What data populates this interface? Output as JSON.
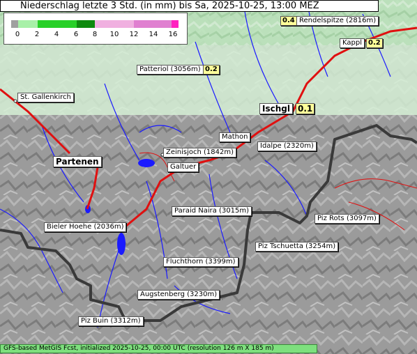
{
  "title": "Niederschlag letzte 3 Std. (in mm) bis Sa, 2025-10-25, 13:00 MEZ",
  "legend": {
    "ticks": [
      "0",
      "2",
      "4",
      "6",
      "8",
      "10",
      "12",
      "14",
      "16"
    ],
    "colors": {
      "zero": "#a0a0a0",
      "light": "#a8f0a8",
      "green": "#28d028",
      "dark_green": "#0e8a0e",
      "pink": "#f0b0e0",
      "magenta": "#e080d0",
      "max": "#ff20c0"
    }
  },
  "places": [
    {
      "name": "Rendelspitze (2816m)",
      "value": "0.4"
    },
    {
      "name": "Kappl",
      "value": "0.2"
    },
    {
      "name": "Patteriol (3056m)",
      "value": "0.2"
    },
    {
      "name": "St. Gallenkirch"
    },
    {
      "name": "Ischgl",
      "value": "0.1"
    },
    {
      "name": "Mathon"
    },
    {
      "name": "Idalpe (2320m)"
    },
    {
      "name": "Zeinisjoch (1842m)"
    },
    {
      "name": "Partenen"
    },
    {
      "name": "Galtuer"
    },
    {
      "name": "Paraid Naira (3015m)"
    },
    {
      "name": "Piz Rots (3097m)"
    },
    {
      "name": "Bieler Hoehe (2036m)"
    },
    {
      "name": "Piz Tschuetta (3254m)"
    },
    {
      "name": "Fluchthorn (3399m)"
    },
    {
      "name": "Augstenberg (3230m)"
    },
    {
      "name": "Piz Buin (3312m)"
    }
  ],
  "footer": "GFS-based MetGIS Fcst, initialized 2025-10-25, 00:00 UTC  (resolution 126 m X 185 m)"
}
